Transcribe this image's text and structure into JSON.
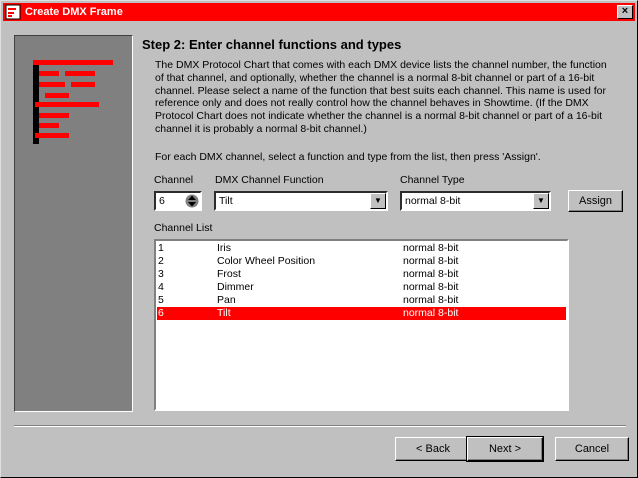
{
  "window": {
    "title": "Create DMX Frame",
    "close_label": "×"
  },
  "step": {
    "title": "Step 2: Enter channel functions and types",
    "description": "The DMX Protocol Chart that comes with each DMX device lists the channel number, the function of that channel, and optionally, whether the channel is a normal 8-bit channel or part of a 16-bit channel. Please select a name of the function that best suits each channel. This name is used for reference only and does not really control how the channel behaves in Showtime. (If the DMX Protocol Chart does not indicate whether the channel is a normal 8-bit channel or part of a 16-bit channel it is probably a normal 8-bit channel.)",
    "instruction": "For each DMX channel, select a function and type from the list, then press 'Assign'."
  },
  "form": {
    "channel_label": "Channel",
    "channel_value": "6",
    "function_label": "DMX Channel Function",
    "function_value": "Tilt",
    "type_label": "Channel Type",
    "type_value": "normal 8-bit",
    "assign_label": "Assign"
  },
  "channel_list": {
    "label": "Channel List",
    "rows": [
      {
        "num": "1",
        "function": "Iris",
        "type": "normal 8-bit"
      },
      {
        "num": "2",
        "function": "Color Wheel Position",
        "type": "normal 8-bit"
      },
      {
        "num": "3",
        "function": "Frost",
        "type": "normal 8-bit"
      },
      {
        "num": "4",
        "function": "Dimmer",
        "type": "normal 8-bit"
      },
      {
        "num": "5",
        "function": "Pan",
        "type": "normal 8-bit"
      },
      {
        "num": "6",
        "function": "Tilt",
        "type": "normal 8-bit"
      }
    ],
    "selected_index": 5
  },
  "buttons": {
    "back": "< Back",
    "next": "Next >",
    "cancel": "Cancel"
  },
  "colors": {
    "accent": "#ff0000",
    "face": "#c0c0c0"
  }
}
